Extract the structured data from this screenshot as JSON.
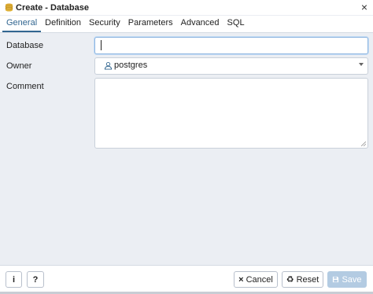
{
  "dialog": {
    "title": "Create - Database",
    "close_glyph": "×",
    "title_icon": "database-icon"
  },
  "tabs": [
    {
      "label": "General",
      "active": true
    },
    {
      "label": "Definition",
      "active": false
    },
    {
      "label": "Security",
      "active": false
    },
    {
      "label": "Parameters",
      "active": false
    },
    {
      "label": "Advanced",
      "active": false
    },
    {
      "label": "SQL",
      "active": false
    }
  ],
  "form": {
    "database_label": "Database",
    "database_value": "",
    "owner_label": "Owner",
    "owner_value": "postgres",
    "comment_label": "Comment",
    "comment_value": ""
  },
  "footer": {
    "info_label": "i",
    "help_label": "?",
    "cancel_label": "Cancel",
    "cancel_icon": "×",
    "reset_label": "Reset",
    "reset_icon": "♻",
    "save_label": "Save",
    "save_icon": "save-icon"
  },
  "colors": {
    "accent": "#326690",
    "save_disabled": "#b3cbe2",
    "background": "#ebeef3"
  }
}
